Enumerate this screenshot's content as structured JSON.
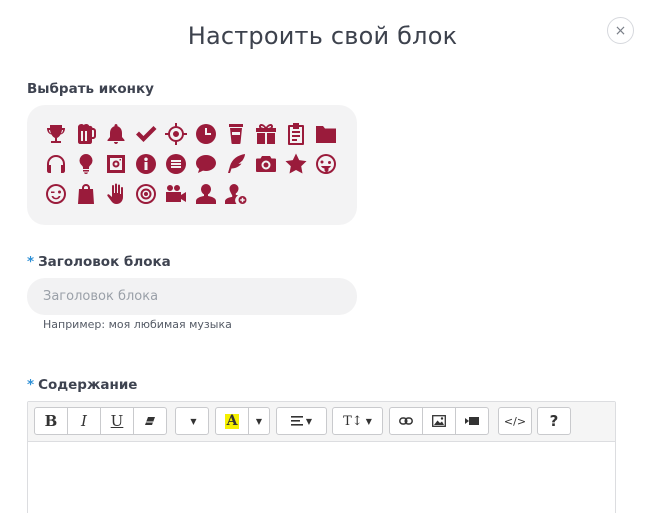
{
  "modal": {
    "title": "Настроить свой блок",
    "close_label": "×"
  },
  "icon_section": {
    "label": "Выбрать иконку",
    "icons": [
      "trophy-icon",
      "beer-mug-icon",
      "bell-icon",
      "checkmark-icon",
      "crosshair-icon",
      "clock-icon",
      "coffee-cup-icon",
      "gift-icon",
      "clipboard-icon",
      "folder-icon",
      "headphones-icon",
      "lightbulb-icon",
      "instagram-icon",
      "info-icon",
      "list-circle-icon",
      "speech-bubble-icon",
      "feather-icon",
      "camera-icon",
      "star-icon",
      "tongue-smiley-icon",
      "wink-smiley-icon",
      "shopping-bag-icon",
      "hand-icon",
      "target-icon",
      "video-camera-icon",
      "user-icon",
      "user-add-icon"
    ],
    "icon_color": "#9a1b3b"
  },
  "title_field": {
    "required_mark": "*",
    "label": "Заголовок блока",
    "placeholder": "Заголовок блока",
    "value": "",
    "hint": "Например: моя любимая музыка"
  },
  "content_field": {
    "required_mark": "*",
    "label": "Содержание"
  },
  "toolbar": {
    "bold": "B",
    "italic": "I",
    "underline": "U",
    "eraser_icon": "eraser-icon",
    "font_dropdown_icon": "caret-down-icon",
    "color_label": "A",
    "color_highlight": "#f5f000",
    "align_icon": "align-left-icon",
    "text_size_label": "T↕",
    "link_icon": "link-icon",
    "image_icon": "image-icon",
    "video_icon": "video-icon",
    "code_label": "</>",
    "help_label": "?"
  }
}
